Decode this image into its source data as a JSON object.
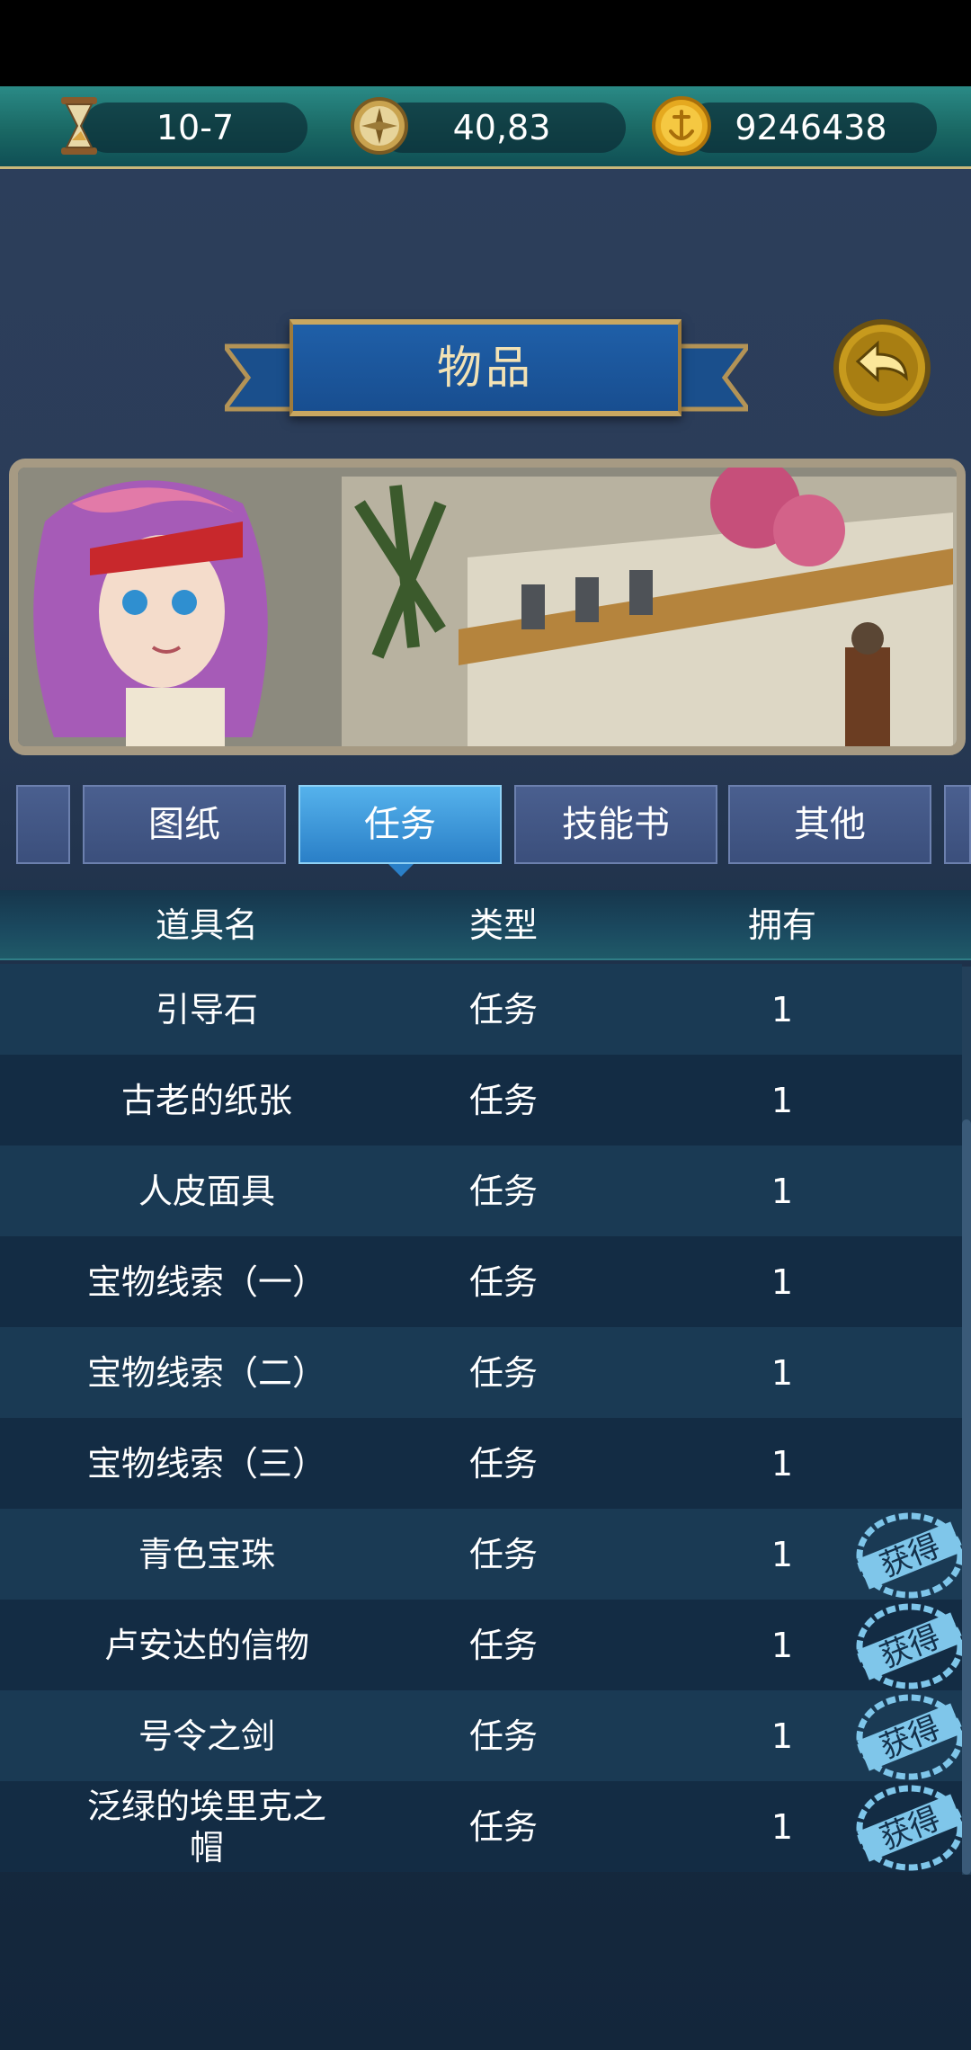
{
  "topbar": {
    "time_value": "10-7",
    "coords_value": "40,83",
    "gold_value": "9246438",
    "icons": [
      "hourglass-icon",
      "compass-icon",
      "gold-coin-icon"
    ]
  },
  "title": "物品",
  "tabs": [
    {
      "label": ""
    },
    {
      "label": "图纸"
    },
    {
      "label": "任务"
    },
    {
      "label": "技能书"
    },
    {
      "label": "其他"
    },
    {
      "label": ""
    }
  ],
  "active_tab": "任务",
  "table": {
    "headers": {
      "name": "道具名",
      "type": "类型",
      "owned": "拥有"
    },
    "rows": [
      {
        "name": "引导石",
        "type": "任务",
        "owned": "1",
        "stamp": ""
      },
      {
        "name": "古老的纸张",
        "type": "任务",
        "owned": "1",
        "stamp": ""
      },
      {
        "name": "人皮面具",
        "type": "任务",
        "owned": "1",
        "stamp": ""
      },
      {
        "name": "宝物线索（一）",
        "type": "任务",
        "owned": "1",
        "stamp": ""
      },
      {
        "name": "宝物线索（二）",
        "type": "任务",
        "owned": "1",
        "stamp": ""
      },
      {
        "name": "宝物线索（三）",
        "type": "任务",
        "owned": "1",
        "stamp": ""
      },
      {
        "name": "青色宝珠",
        "type": "任务",
        "owned": "1",
        "stamp": "获得"
      },
      {
        "name": "卢安达的信物",
        "type": "任务",
        "owned": "1",
        "stamp": "获得"
      },
      {
        "name": "号令之剑",
        "type": "任务",
        "owned": "1",
        "stamp": "获得"
      },
      {
        "name": "泛绿的埃里克之帽",
        "type": "任务",
        "owned": "1",
        "stamp": "获得"
      }
    ]
  },
  "colors": {
    "accent_gold": "#c9a760",
    "tab_active": "#2a7fc7",
    "tab_inactive": "#3b4f7c",
    "stamp": "#7fc6ea"
  }
}
